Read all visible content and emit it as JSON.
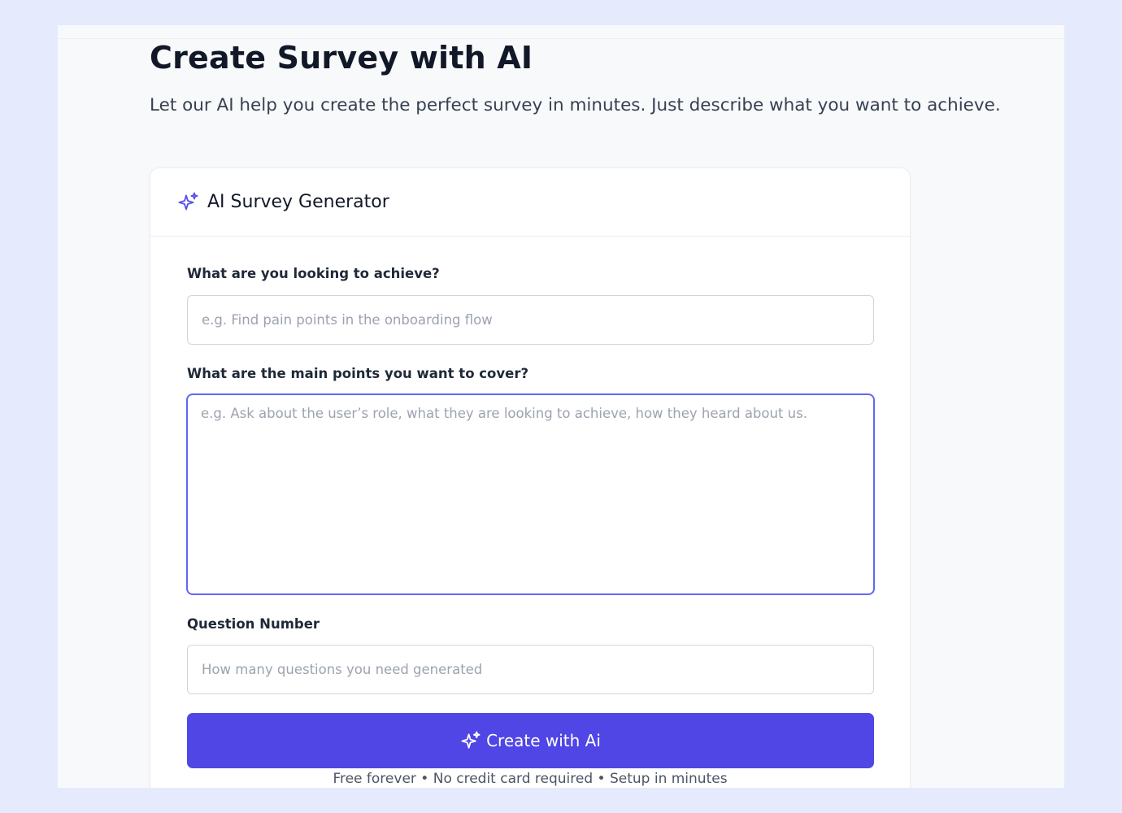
{
  "page": {
    "title": "Create Survey with AI",
    "subtitle": "Let our AI help you create the perfect survey in minutes. Just describe what you want to achieve."
  },
  "card": {
    "icon": "sparkles-icon",
    "title": "AI Survey Generator"
  },
  "form": {
    "goal": {
      "label": "What are you looking to achieve?",
      "value": "",
      "placeholder": "e.g. Find pain points in the onboarding flow"
    },
    "points": {
      "label": "What are the main points you want to cover?",
      "value": "",
      "placeholder": "e.g. Ask about the user’s role, what they are looking to achieve, how they heard about us."
    },
    "question_number": {
      "label": "Question Number",
      "value": "",
      "placeholder": "How many questions you need generated"
    }
  },
  "actions": {
    "create": {
      "icon": "sparkles-icon",
      "label": "Create with Ai"
    }
  },
  "footnote": "Free forever • No credit card required • Setup in minutes",
  "colors": {
    "page_background": "#e6eafd",
    "content_background": "#f8f9fb",
    "accent": "#4f46e5",
    "focus_border": "#6366f1",
    "icon": "#5b50e8"
  }
}
